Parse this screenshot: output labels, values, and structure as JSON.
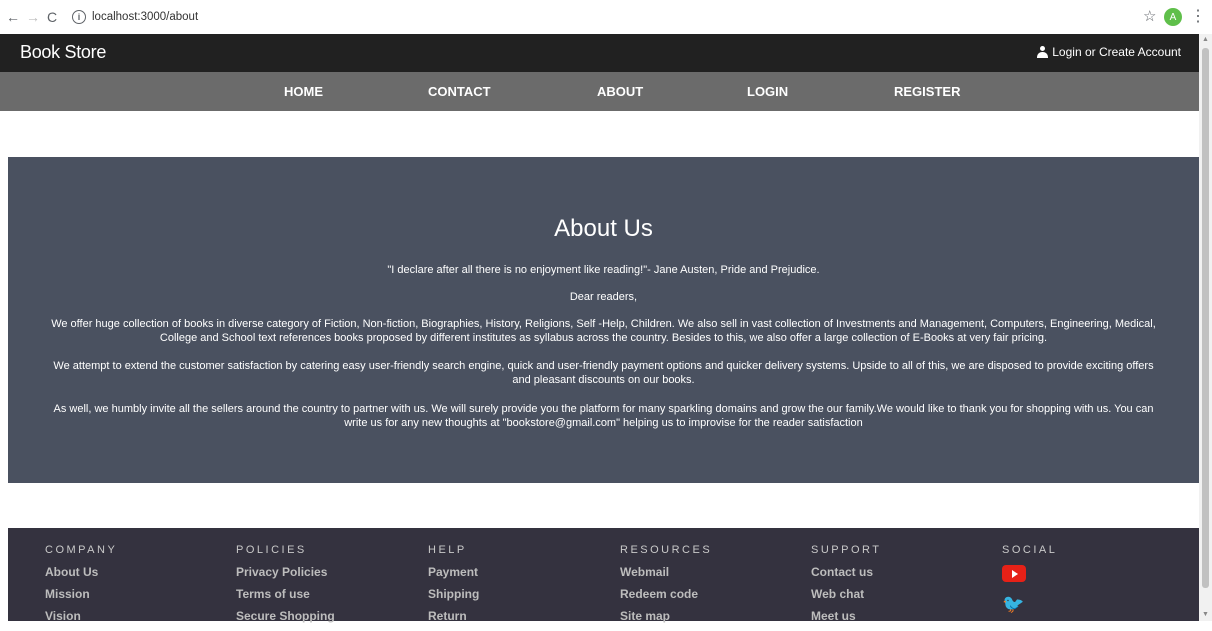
{
  "browser": {
    "url": "localhost:3000/about",
    "profile_initial": "A"
  },
  "header": {
    "brand": "Book Store",
    "login_link": "Login or Create Account"
  },
  "nav": {
    "items": [
      {
        "label": "HOME"
      },
      {
        "label": "CONTACT"
      },
      {
        "label": "ABOUT"
      },
      {
        "label": "LOGIN"
      },
      {
        "label": "REGISTER"
      }
    ]
  },
  "about": {
    "title": "About Us",
    "quote": "\"I declare after all there is no enjoyment like reading!\"- Jane Austen, Pride and Prejudice.",
    "greeting": "Dear readers,",
    "paragraph1": "We offer huge collection of books in diverse category of Fiction, Non-fiction, Biographies, History, Religions, Self -Help, Children. We also sell in vast collection of Investments and Management, Computers, Engineering, Medical, College and School text references books proposed by different institutes as syllabus across the country. Besides to this, we also offer a large collection of E-Books at very fair pricing.",
    "paragraph2": "We attempt to extend the customer satisfaction by catering easy user-friendly search engine, quick and user-friendly payment options and quicker delivery systems. Upside to all of this, we are disposed to provide exciting offers and pleasant discounts on our books.",
    "paragraph3": "As well, we humbly invite all the sellers around the country to partner with us. We will surely provide you the platform for many sparkling domains and grow the our family.We would like to thank you for shopping with us. You can write us for any new thoughts at \"bookstore@gmail.com\" helping us to improvise for the reader satisfaction"
  },
  "footer": {
    "columns": [
      {
        "heading": "COMPANY",
        "items": [
          "About Us",
          "Mission",
          "Vision"
        ]
      },
      {
        "heading": "POLICIES",
        "items": [
          "Privacy Policies",
          "Terms of use",
          "Secure Shopping"
        ]
      },
      {
        "heading": "HELP",
        "items": [
          "Payment",
          "Shipping",
          "Return"
        ]
      },
      {
        "heading": "RESOURCES",
        "items": [
          "Webmail",
          "Redeem code",
          "Site map"
        ]
      },
      {
        "heading": "SUPPORT",
        "items": [
          "Contact us",
          "Web chat",
          "Meet us"
        ]
      }
    ],
    "social": {
      "heading": "SOCIAL",
      "icons": [
        "youtube-icon",
        "twitter-icon"
      ]
    }
  },
  "colors": {
    "topbar": "#212121",
    "navbar": "#6b6b6b",
    "about_bg": "#4a5160",
    "footer_bg": "#34323f"
  }
}
